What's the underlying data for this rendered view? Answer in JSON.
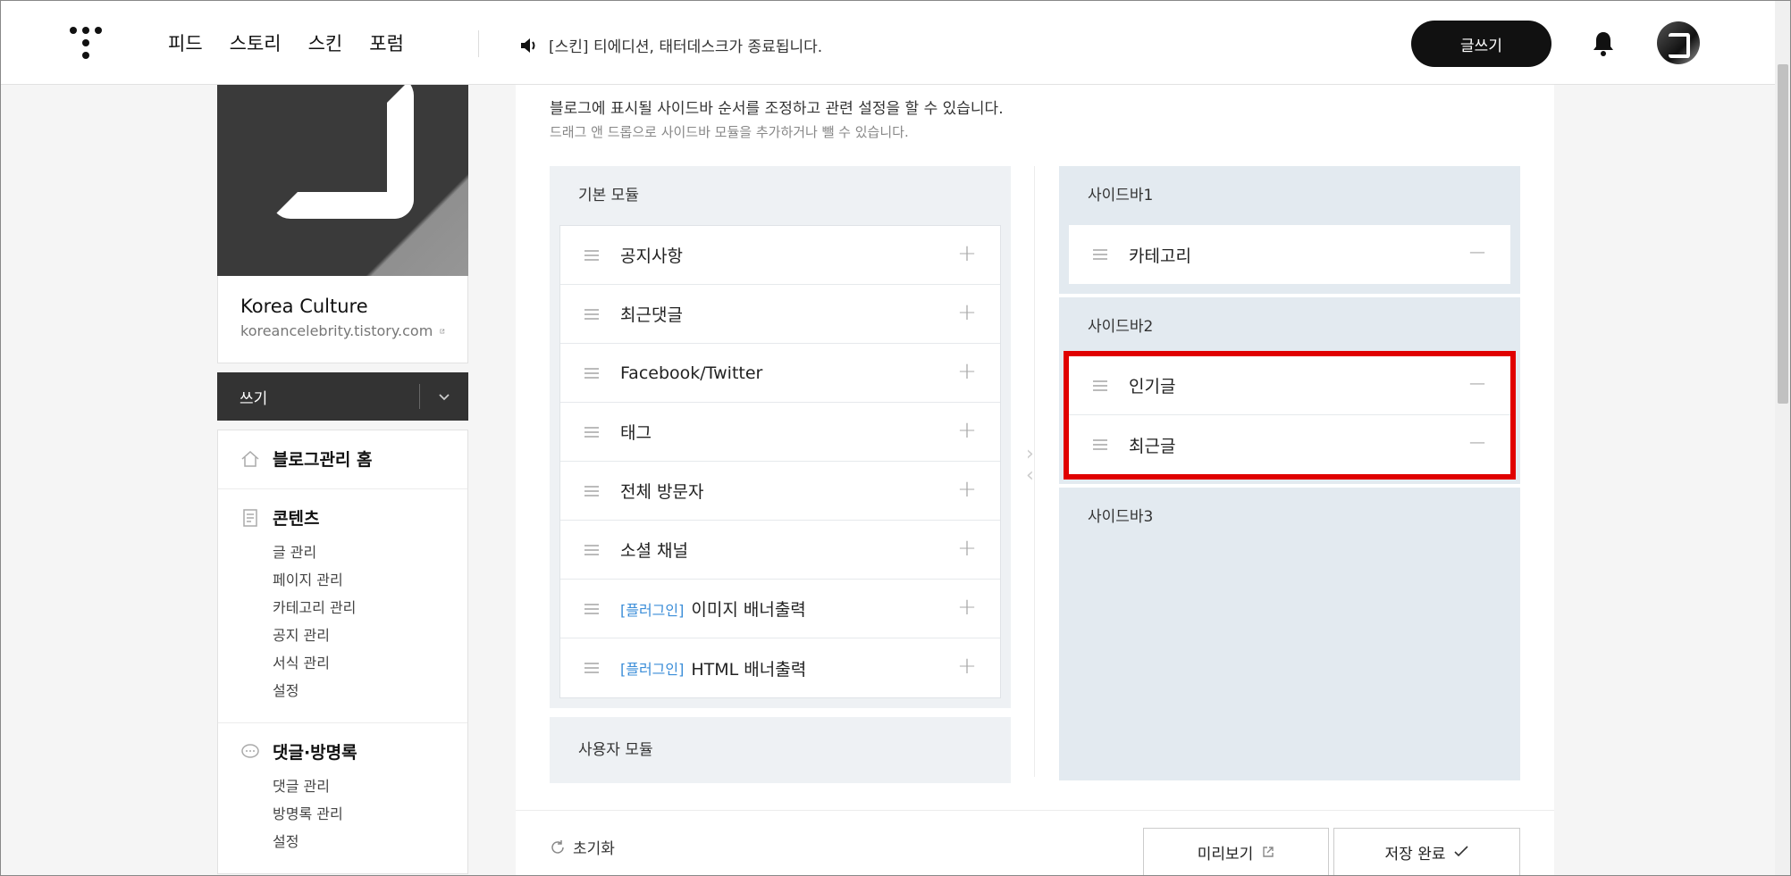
{
  "topbar": {
    "nav": [
      "피드",
      "스토리",
      "스킨",
      "포럼"
    ],
    "notice": "[스킨] 티에디션, 태터데스크가 종료됩니다.",
    "write_button": "글쓰기"
  },
  "blog": {
    "name": "Korea Culture",
    "url": "koreancelebrity.tistory.com"
  },
  "write_dropdown": {
    "label": "쓰기"
  },
  "menu": {
    "home": "블로그관리 홈",
    "contents": {
      "title": "콘텐츠",
      "items": [
        "글 관리",
        "페이지 관리",
        "카테고리 관리",
        "공지 관리",
        "서식 관리",
        "설정"
      ]
    },
    "comments": {
      "title": "댓글·방명록",
      "items": [
        "댓글 관리",
        "방명록 관리",
        "설정"
      ]
    }
  },
  "main": {
    "desc1": "블로그에 표시될 사이드바 순서를 조정하고 관련 설정을 할 수 있습니다.",
    "desc2": "드래그 앤 드롭으로 사이드바 모듈을 추가하거나 뺄 수 있습니다.",
    "basic_modules": {
      "title": "기본 모듈",
      "items": [
        {
          "tag": "",
          "name": "공지사항"
        },
        {
          "tag": "",
          "name": "최근댓글"
        },
        {
          "tag": "",
          "name": "Facebook/Twitter"
        },
        {
          "tag": "",
          "name": "태그"
        },
        {
          "tag": "",
          "name": "전체 방문자"
        },
        {
          "tag": "",
          "name": "소셜 채널"
        },
        {
          "tag": "[플러그인]",
          "name": "이미지 배너출력"
        },
        {
          "tag": "[플러그인]",
          "name": "HTML 배너출력"
        }
      ]
    },
    "user_modules": {
      "title": "사용자 모듈"
    },
    "sidebar1": {
      "title": "사이드바1",
      "items": [
        "카테고리"
      ]
    },
    "sidebar2": {
      "title": "사이드바2",
      "items": [
        "인기글",
        "최근글"
      ]
    },
    "sidebar3": {
      "title": "사이드바3"
    },
    "reset": "초기화",
    "preview": "미리보기",
    "save": "저장 완료"
  }
}
